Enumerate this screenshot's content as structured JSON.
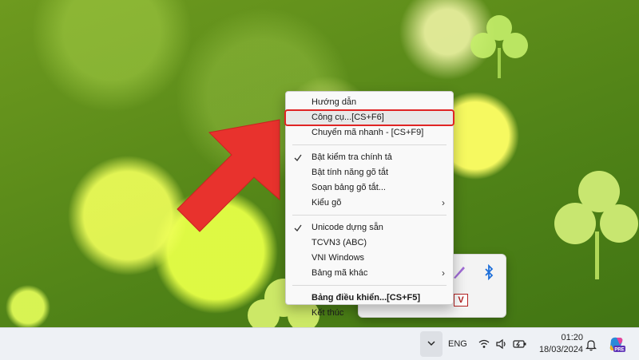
{
  "context_menu": {
    "items": [
      {
        "label": "Hướng dẫn",
        "checked": false,
        "bold": false,
        "submenu": false
      },
      {
        "label": "Công cụ...[CS+F6]",
        "checked": false,
        "bold": false,
        "submenu": false,
        "highlighted": true
      },
      {
        "label": "Chuyển mã nhanh - [CS+F9]",
        "checked": false,
        "bold": false,
        "submenu": false
      },
      {
        "label": "Bật kiểm tra chính tả",
        "checked": true,
        "bold": false,
        "submenu": false
      },
      {
        "label": "Bật tính năng gõ tắt",
        "checked": false,
        "bold": false,
        "submenu": false
      },
      {
        "label": "Soạn bảng gõ tắt...",
        "checked": false,
        "bold": false,
        "submenu": false
      },
      {
        "label": "Kiểu gõ",
        "checked": false,
        "bold": false,
        "submenu": true
      },
      {
        "label": "Unicode dựng sẵn",
        "checked": true,
        "bold": false,
        "submenu": false
      },
      {
        "label": "TCVN3 (ABC)",
        "checked": false,
        "bold": false,
        "submenu": false
      },
      {
        "label": "VNI Windows",
        "checked": false,
        "bold": false,
        "submenu": false
      },
      {
        "label": "Bảng mã khác",
        "checked": false,
        "bold": false,
        "submenu": true
      },
      {
        "label": "Bảng điều khiển...[CS+F5]",
        "checked": false,
        "bold": true,
        "submenu": false
      },
      {
        "label": "Kết thúc",
        "checked": false,
        "bold": false,
        "submenu": false
      }
    ],
    "submenu_glyph": "›",
    "check_glyph": "✓"
  },
  "tray_popup": {
    "icons": [
      "pen-icon",
      "bluetooth-icon",
      "unikey-v-icon"
    ],
    "unikey_letter": "V"
  },
  "taskbar": {
    "language": "ENG",
    "time": "01:20",
    "date": "18/03/2024",
    "icons": [
      "chevron-up-icon",
      "wifi-icon",
      "volume-icon",
      "battery-icon",
      "bell-icon",
      "copilot-icon"
    ],
    "copilot_badge": "PRE"
  },
  "colors": {
    "highlight_border": "#e02424",
    "arrow": "#e8322d",
    "menu_bg": "#f9f9f9",
    "taskbar_bg": "#eef1f5"
  }
}
